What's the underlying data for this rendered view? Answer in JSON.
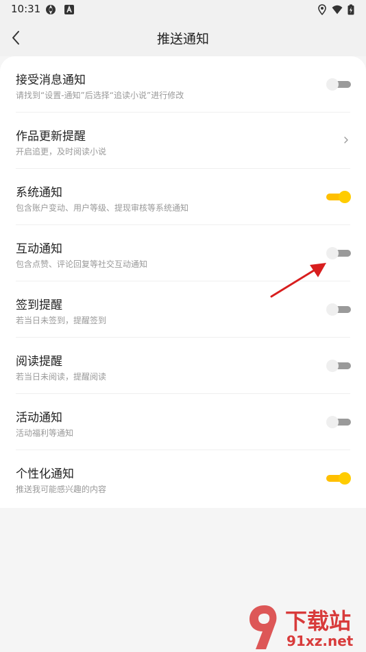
{
  "status_bar": {
    "time": "10:31",
    "left_icons": [
      "aperture-icon",
      "a-badge-icon"
    ],
    "right_icons": [
      "location-icon",
      "wifi-icon",
      "battery-icon"
    ]
  },
  "nav": {
    "title": "推送通知",
    "back_icon": "back-chevron-icon"
  },
  "settings": [
    {
      "title": "接受消息通知",
      "subtitle": "请找到“设置-通知”后选择“追读小说”进行修改",
      "control": "toggle",
      "enabled": false
    },
    {
      "title": "作品更新提醒",
      "subtitle": "开启追更，及时阅读小说",
      "control": "chevron"
    },
    {
      "title": "系统通知",
      "subtitle": "包含账户变动、用户等级、提现审核等系统通知",
      "control": "toggle",
      "enabled": true
    },
    {
      "title": "互动通知",
      "subtitle": "包含点赞、评论回复等社交互动通知",
      "control": "toggle",
      "enabled": false
    },
    {
      "title": "签到提醒",
      "subtitle": "若当日未签到，提醒签到",
      "control": "toggle",
      "enabled": false
    },
    {
      "title": "阅读提醒",
      "subtitle": "若当日未阅读，提醒阅读",
      "control": "toggle",
      "enabled": false
    },
    {
      "title": "活动通知",
      "subtitle": "活动福利等通知",
      "control": "toggle",
      "enabled": false
    },
    {
      "title": "个性化通知",
      "subtitle": "推送我可能感兴趣的内容",
      "control": "toggle",
      "enabled": true
    }
  ],
  "watermark": {
    "line1": "下载站",
    "line2": "91xz.net"
  },
  "colors": {
    "accent": "#ffcc00",
    "annotation_arrow": "#d81e1e",
    "watermark": "#d83b3b"
  }
}
